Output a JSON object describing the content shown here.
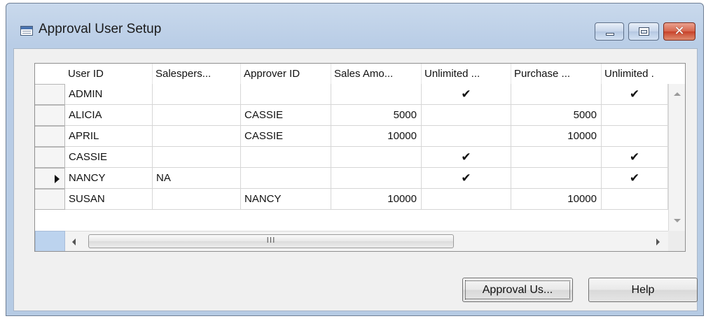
{
  "window": {
    "title": "Approval User Setup",
    "icon": "table-window-icon",
    "controls": {
      "minimize": "minimize",
      "maximize": "maximize",
      "close": "✕"
    }
  },
  "table": {
    "columns": [
      "User ID",
      "Salespers...",
      "Approver ID",
      "Sales Amo...",
      "Unlimited ...",
      "Purchase ...",
      "Unlimited ."
    ],
    "rows": [
      {
        "user_id": "ADMIN",
        "salesperson": "",
        "approver_id": "",
        "sales_amount": "",
        "unlimited_sales": "✔",
        "purchase_amount": "",
        "unlimited_purchase": "✔",
        "current": false
      },
      {
        "user_id": "ALICIA",
        "salesperson": "",
        "approver_id": "CASSIE",
        "sales_amount": "5000",
        "unlimited_sales": "",
        "purchase_amount": "5000",
        "unlimited_purchase": "",
        "current": false
      },
      {
        "user_id": "APRIL",
        "salesperson": "",
        "approver_id": "CASSIE",
        "sales_amount": "10000",
        "unlimited_sales": "",
        "purchase_amount": "10000",
        "unlimited_purchase": "",
        "current": false
      },
      {
        "user_id": "CASSIE",
        "salesperson": "",
        "approver_id": "",
        "sales_amount": "",
        "unlimited_sales": "✔",
        "purchase_amount": "",
        "unlimited_purchase": "✔",
        "current": false
      },
      {
        "user_id": "NANCY",
        "salesperson": "NA",
        "approver_id": "",
        "sales_amount": "",
        "unlimited_sales": "✔",
        "purchase_amount": "",
        "unlimited_purchase": "✔",
        "current": true
      },
      {
        "user_id": "SUSAN",
        "salesperson": "",
        "approver_id": "NANCY",
        "sales_amount": "10000",
        "unlimited_sales": "",
        "purchase_amount": "10000",
        "unlimited_purchase": "",
        "current": false
      }
    ],
    "hscroll_grip": "III"
  },
  "buttons": {
    "approval_label": "Approval Us...",
    "help_label": "Help"
  }
}
